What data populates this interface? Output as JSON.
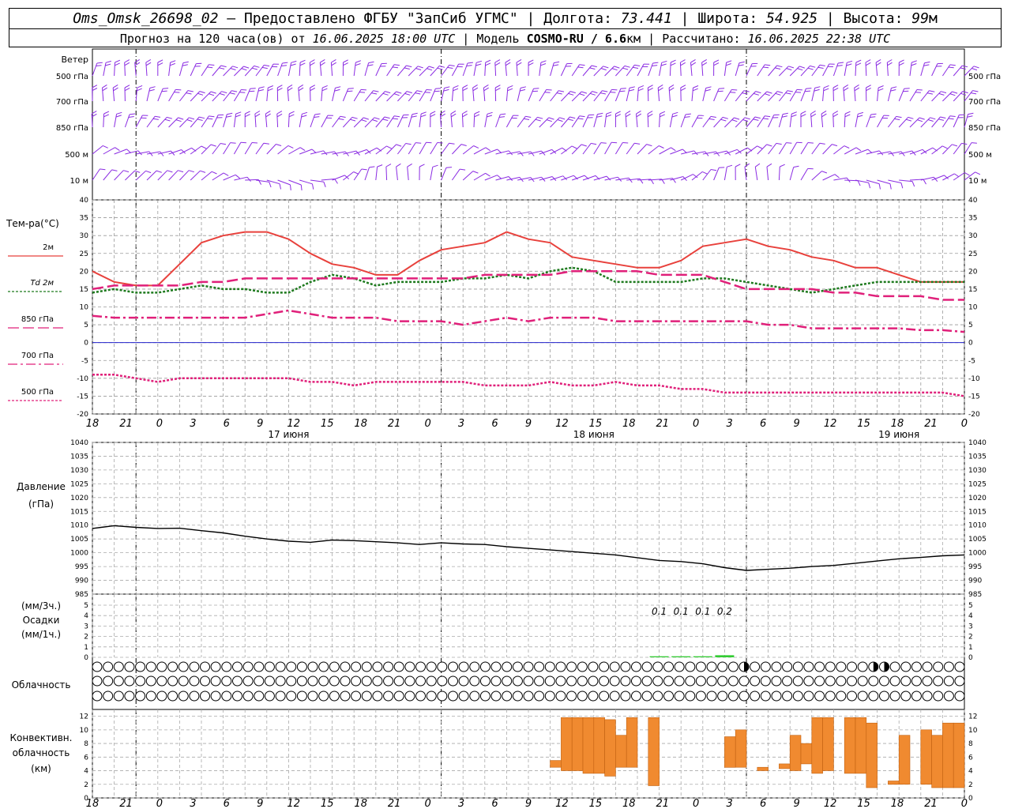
{
  "header": {
    "station": "Oms_Omsk_26698_02",
    "sep_dash": " – ",
    "provider_label": "Предоставлено ФГБУ \"ЗапСиб УГМС\"",
    "sep": " | ",
    "lon_label": "Долгота: ",
    "lon": "73.441",
    "lat_label": "Широта: ",
    "lat": "54.925",
    "alt_label": "Высота: ",
    "alt": "99",
    "alt_unit": "м",
    "forecast_label": "Прогноз на 120 часа(ов) от ",
    "forecast_time": "16.06.2025 18:00 UTC",
    "model_label": "Модель ",
    "model": "COSMO-RU / 6.6",
    "model_unit": "км",
    "computed_label": "Рассчитано: ",
    "computed_time": "16.06.2025 22:38 UTC"
  },
  "labels": {
    "wind_title": "Ветер",
    "wind_levels": [
      "500 гПа",
      "700 гПа",
      "850 гПа",
      "500 м",
      "10 м"
    ],
    "temp_title": "Тем-ра(°C)",
    "legend": [
      "2м",
      "Td 2м",
      "850 гПа",
      "700 гПа",
      "500 гПа"
    ],
    "pressure_title": "Давление",
    "pressure_unit": "(гПа)",
    "precip_unit_1": "(мм/3ч.)",
    "precip_title": "Осадки",
    "precip_unit_2": "(мм/1ч.)",
    "cloud_title": "Облачность",
    "conv_title_1": "Конвективн.",
    "conv_title_2": "облачность",
    "conv_unit": "(км)",
    "dates": [
      "17 июня",
      "18 июня",
      "19 июня"
    ],
    "hour_ticks": [
      "18",
      "21",
      "0",
      "3",
      "6",
      "9",
      "12",
      "15",
      "18",
      "21",
      "0",
      "3",
      "6",
      "9",
      "12",
      "15",
      "18",
      "21",
      "0",
      "3",
      "6",
      "9",
      "12",
      "15",
      "18",
      "21",
      "0"
    ],
    "precip_values": [
      "0.1",
      "0.1",
      "0.1",
      "0.2"
    ]
  },
  "colors": {
    "wind": "#8a2be2",
    "t2m": "#e8413c",
    "td2m": "#1e7a1e",
    "t850": "#e0207a",
    "t700": "#e0207a",
    "t500": "#e0207a",
    "zero_line": "#2222cc",
    "precip": "#33cc33",
    "convective": "#f08a30"
  },
  "chart_data": [
    {
      "type": "line",
      "title": "Тем-ра(°C)",
      "x_hours": [
        0,
        3,
        6,
        9,
        12,
        15,
        18,
        21,
        24,
        27,
        30,
        33,
        36,
        39,
        42,
        45,
        48,
        51,
        54,
        57,
        60,
        63,
        66,
        69,
        72,
        75,
        78,
        81,
        84,
        87,
        90,
        93,
        96,
        99,
        102,
        105,
        108,
        111,
        114,
        117,
        120
      ],
      "ylim": [
        -20,
        40
      ],
      "series": [
        {
          "name": "2м",
          "values": [
            20,
            17,
            16,
            16,
            22,
            28,
            30,
            31,
            31,
            29,
            25,
            22,
            21,
            19,
            19,
            23,
            26,
            27,
            28,
            31,
            29,
            28,
            24,
            23,
            22,
            21,
            21,
            23,
            27,
            28,
            29,
            27,
            26,
            24,
            23,
            21,
            21,
            19,
            17,
            17,
            17
          ]
        },
        {
          "name": "Td 2м",
          "values": [
            14,
            15,
            14,
            14,
            15,
            16,
            15,
            15,
            14,
            14,
            17,
            19,
            18,
            16,
            17,
            17,
            17,
            18,
            18,
            19,
            18,
            20,
            21,
            20,
            17,
            17,
            17,
            17,
            18,
            18,
            17,
            16,
            15,
            14,
            15,
            16,
            17,
            17,
            17,
            17,
            17
          ]
        },
        {
          "name": "850 гПа",
          "values": [
            15,
            16,
            16,
            16,
            16,
            17,
            17,
            18,
            18,
            18,
            18,
            18,
            18,
            18,
            18,
            18,
            18,
            18,
            19,
            19,
            19,
            19,
            20,
            20,
            20,
            20,
            19,
            19,
            19,
            17,
            15,
            15,
            15,
            15,
            14,
            14,
            13,
            13,
            13,
            12,
            12
          ]
        },
        {
          "name": "700 гПа",
          "values": [
            7.5,
            7,
            7,
            7,
            7,
            7,
            7,
            7,
            8,
            9,
            8,
            7,
            7,
            7,
            6,
            6,
            6,
            5,
            6,
            7,
            6,
            7,
            7,
            7,
            6,
            6,
            6,
            6,
            6,
            6,
            6,
            5,
            5,
            4,
            4,
            4,
            4,
            4,
            3.5,
            3.5,
            3
          ]
        },
        {
          "name": "500 гПа",
          "values": [
            -9,
            -9,
            -10,
            -11,
            -10,
            -10,
            -10,
            -10,
            -10,
            -10,
            -11,
            -11,
            -12,
            -11,
            -11,
            -11,
            -11,
            -11,
            -12,
            -12,
            -12,
            -11,
            -12,
            -12,
            -11,
            -12,
            -12,
            -13,
            -13,
            -14,
            -14,
            -14,
            -14,
            -14,
            -14,
            -14,
            -14,
            -14,
            -14,
            -14,
            -15
          ]
        }
      ]
    },
    {
      "type": "line",
      "title": "Давление",
      "x_hours": [
        0,
        3,
        6,
        9,
        12,
        15,
        18,
        21,
        24,
        27,
        30,
        33,
        36,
        39,
        42,
        45,
        48,
        51,
        54,
        57,
        60,
        63,
        66,
        69,
        72,
        75,
        78,
        81,
        84,
        87,
        90,
        93,
        96,
        99,
        102,
        105,
        108,
        111,
        114,
        117,
        120
      ],
      "ylim": [
        985,
        1040
      ],
      "values": [
        1008.8,
        1009.8,
        1009.2,
        1008.8,
        1008.9,
        1008,
        1007.2,
        1006,
        1005,
        1004.2,
        1003.8,
        1004.6,
        1004.4,
        1004,
        1003.6,
        1003,
        1003.6,
        1003.2,
        1003,
        1002.2,
        1001.6,
        1001,
        1000.4,
        999.8,
        999.2,
        998.2,
        997.2,
        996.8,
        996,
        994.6,
        993.6,
        994,
        994.4,
        995,
        995.4,
        996.2,
        997,
        997.8,
        998.3,
        998.9,
        999.2
      ]
    },
    {
      "type": "bar",
      "title": "Осадки",
      "x_hours": [
        78,
        81,
        84,
        87
      ],
      "values": [
        0.1,
        0.1,
        0.1,
        0.2
      ],
      "ylim": [
        0,
        5
      ]
    },
    {
      "type": "table",
      "title": "Облачность",
      "rows": [
        "OOOOOOOOOOOOOOOOOOOOOOOOOOOOOOOOOOOOOOOOOOOOOOOOOOOOOOOOOOOOOOOOOOOOOOOOOOOOOOOOOOOOOOOOOOOOOOOOOOOOOOOOOOOO",
        "OOOOOOOOOOOOOOOOOOOOOOOOOOOOOOOOOOOOOOOOOOOOOOOOOOOOOOOOOOOOOOOOOOOOOOOOOOOOOOOOOOOOOOOOOOOOOOOOOOOOOOOOOOOO",
        "OOOOOOOOOOOOOOOOOOOOOOOOOOOOOOOOOOOOOOOOOOOOOOOOOOOOOOOOOOOOOOOOOOOOOOOOOOOOOOOOOOOOOOOOOOOOOOOOOOOOOOOOOOOO"
      ],
      "row_codes": [
        "0000000000000000000000000000000000000000000000000000000000002000000000002200000000444444444444434334444440444444444444444444444440000004444444444400000432234422344",
        "0000000000000000000000000000000000000000000000000000000000000000000000000000000000000000000000000000000000000000000000000000000000000000000000000000000000000000000",
        "0000000000000000000000000000000000000000000000000000000000000000000000000000000000000000000000000000000000000000000000000000000000000000000000000000000000000000000"
      ]
    },
    {
      "type": "bar",
      "title": "Конвективн. облачность",
      "ylim": [
        0,
        13
      ],
      "bars": [
        {
          "x0": 63.0,
          "x1": 64.5,
          "base": 4.5,
          "top": 5.5
        },
        {
          "x0": 64.5,
          "x1": 66.0,
          "base": 4.0,
          "top": 11.8
        },
        {
          "x0": 66.0,
          "x1": 67.5,
          "base": 4.0,
          "top": 11.8
        },
        {
          "x0": 67.5,
          "x1": 69.0,
          "base": 3.6,
          "top": 11.8
        },
        {
          "x0": 69.0,
          "x1": 70.5,
          "base": 3.6,
          "top": 11.8
        },
        {
          "x0": 70.5,
          "x1": 72.0,
          "base": 3.2,
          "top": 11.5
        },
        {
          "x0": 72.0,
          "x1": 73.5,
          "base": 4.5,
          "top": 9.2
        },
        {
          "x0": 73.5,
          "x1": 75.0,
          "base": 4.5,
          "top": 11.8
        },
        {
          "x0": 76.5,
          "x1": 78.0,
          "base": 1.8,
          "top": 11.8
        },
        {
          "x0": 87.0,
          "x1": 88.5,
          "base": 4.5,
          "top": 9.0
        },
        {
          "x0": 88.5,
          "x1": 90.0,
          "base": 4.5,
          "top": 10.0
        },
        {
          "x0": 91.5,
          "x1": 93.0,
          "base": 4.0,
          "top": 4.5
        },
        {
          "x0": 94.5,
          "x1": 96.0,
          "base": 4.3,
          "top": 5.0
        },
        {
          "x0": 96.0,
          "x1": 97.5,
          "base": 4.0,
          "top": 9.2
        },
        {
          "x0": 97.5,
          "x1": 99.0,
          "base": 5.0,
          "top": 8.0
        },
        {
          "x0": 99.0,
          "x1": 100.5,
          "base": 3.6,
          "top": 11.8
        },
        {
          "x0": 100.5,
          "x1": 102.0,
          "base": 4.0,
          "top": 11.8
        },
        {
          "x0": 103.5,
          "x1": 105.0,
          "base": 3.6,
          "top": 11.8
        },
        {
          "x0": 105.0,
          "x1": 106.5,
          "base": 3.6,
          "top": 11.8
        },
        {
          "x0": 106.5,
          "x1": 108.0,
          "base": 1.5,
          "top": 11.0
        },
        {
          "x0": 109.5,
          "x1": 111.0,
          "base": 2.0,
          "top": 2.5
        },
        {
          "x0": 111.0,
          "x1": 112.5,
          "base": 2.0,
          "top": 9.2
        },
        {
          "x0": 114.0,
          "x1": 115.5,
          "base": 2.0,
          "top": 10.0
        },
        {
          "x0": 115.5,
          "x1": 117.0,
          "base": 1.5,
          "top": 9.2
        },
        {
          "x0": 117.0,
          "x1": 118.5,
          "base": 1.5,
          "top": 11.0
        },
        {
          "x0": 118.5,
          "x1": 120.0,
          "base": 1.5,
          "top": 11.0
        }
      ]
    }
  ]
}
